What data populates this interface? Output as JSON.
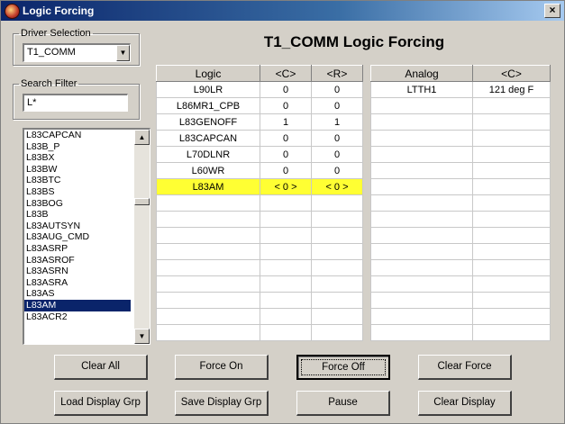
{
  "window": {
    "title": "Logic Forcing",
    "close_symbol": "×"
  },
  "driver_selection": {
    "legend": "Driver Selection",
    "value": "T1_COMM"
  },
  "search_filter": {
    "legend": "Search Filter",
    "value": "L*"
  },
  "signal_list": {
    "items": [
      "L83CAPCAN",
      "L83B_P",
      "L83BX",
      "L83BW",
      "L83BTC",
      "L83BS",
      "L83BOG",
      "L83B",
      "L83AUTSYN",
      "L83AUG_CMD",
      "L83ASRP",
      "L83ASROF",
      "L83ASRN",
      "L83ASRA",
      "L83AS",
      "L83AM",
      "L83ACR2"
    ],
    "selected": "L83AM"
  },
  "page_title": "T1_COMM Logic Forcing",
  "logic_table": {
    "headers": [
      "Logic",
      "<C>",
      "<R>"
    ],
    "rows": [
      [
        "L90LR",
        "0",
        "0"
      ],
      [
        "L86MR1_CPB",
        "0",
        "0"
      ],
      [
        "L83GENOFF",
        "1",
        "1"
      ],
      [
        "L83CAPCAN",
        "0",
        "0"
      ],
      [
        "L70DLNR",
        "0",
        "0"
      ],
      [
        "L60WR",
        "0",
        "0"
      ],
      [
        "L83AM",
        "< 0 >",
        "< 0 >"
      ]
    ],
    "highlighted_row": 6,
    "highlight_color": "#ffff33"
  },
  "analog_table": {
    "headers": [
      "Analog",
      "<C>"
    ],
    "rows": [
      [
        "LTTH1",
        "121 deg F"
      ]
    ]
  },
  "buttons": {
    "clear_all": "Clear All",
    "force_on": "Force On",
    "force_off": "Force Off",
    "clear_force": "Clear Force",
    "load_display_grp": "Load Display Grp",
    "save_display_grp": "Save Display Grp",
    "pause": "Pause",
    "clear_display": "Clear Display"
  }
}
